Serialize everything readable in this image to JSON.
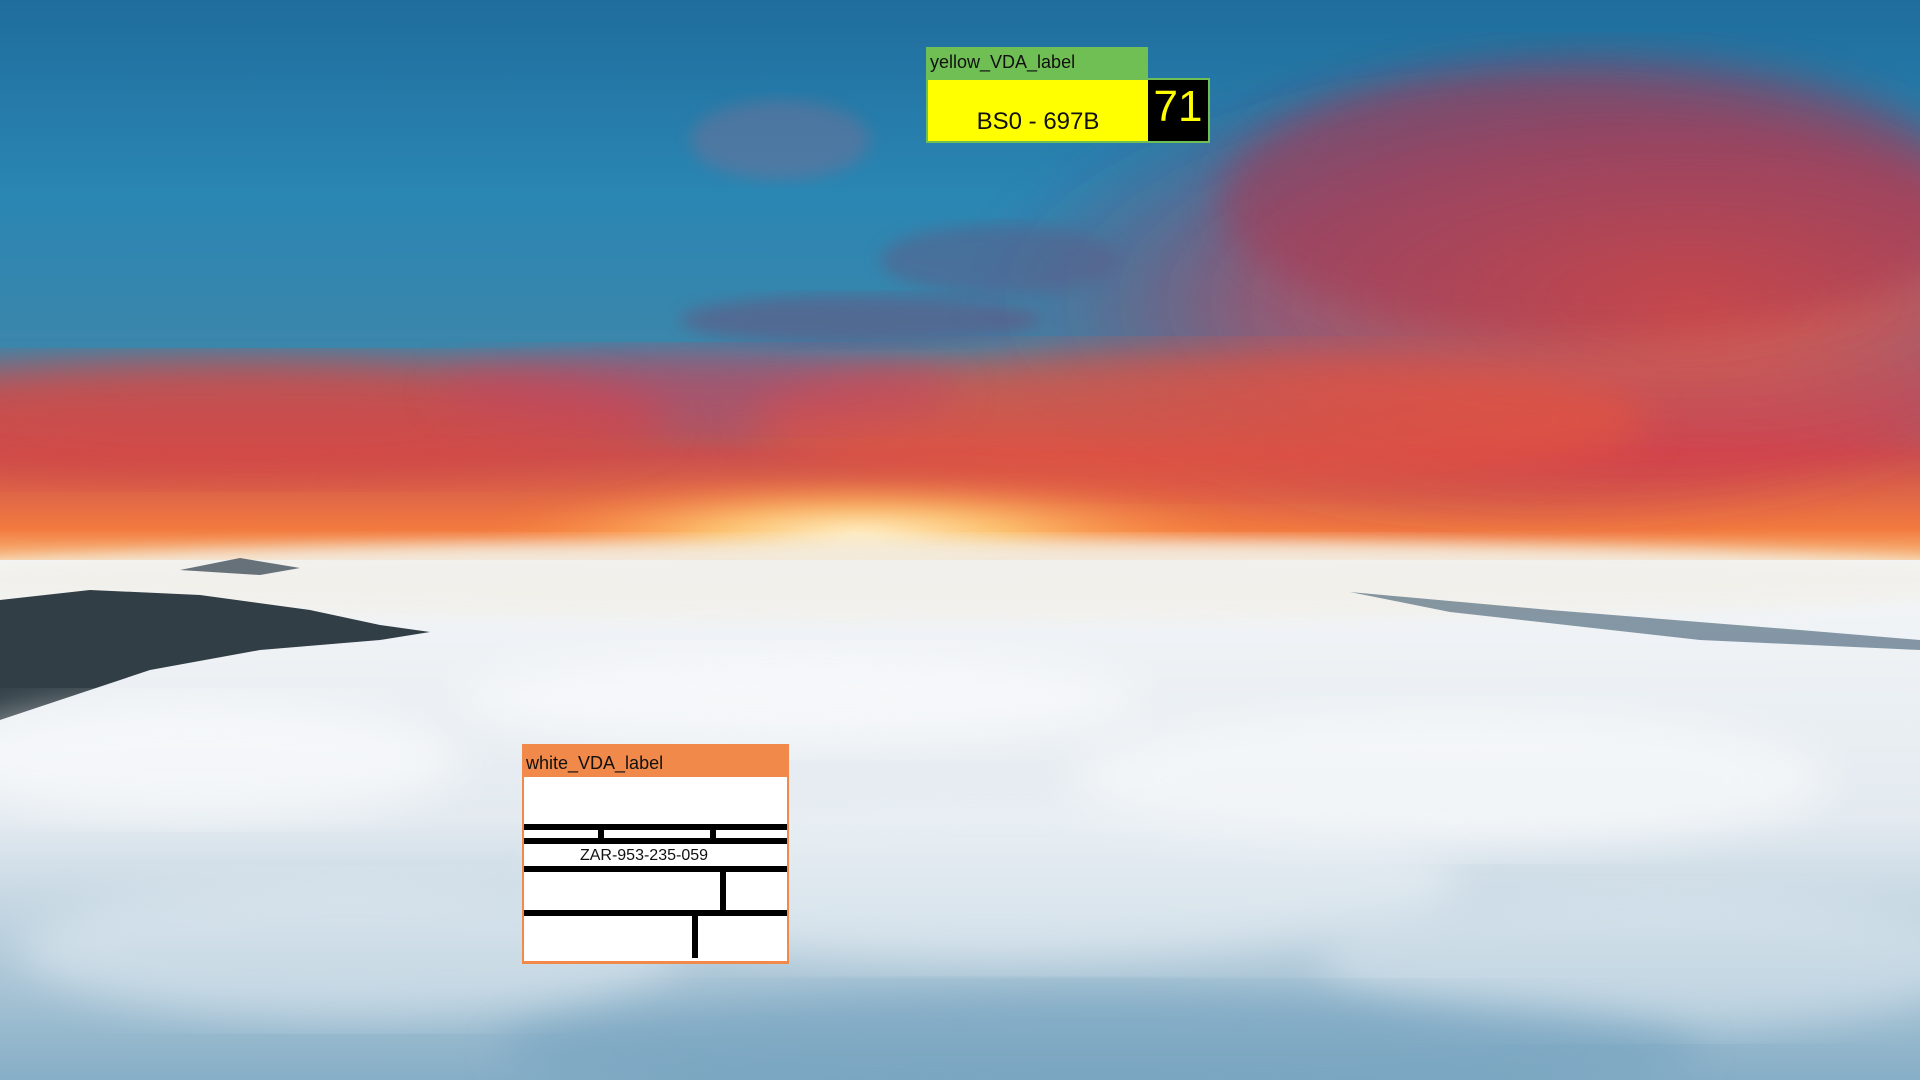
{
  "labels": {
    "yellow": {
      "tag": "yellow_VDA_label",
      "code": "BS0 - 697B",
      "number": "71",
      "tag_color": "#6fbf55",
      "fill_color": "#ffff00"
    },
    "white": {
      "tag": "white_VDA_label",
      "code": "ZAR-953-235-059",
      "tag_color": "#f0894a",
      "fill_color": "#ffffff"
    }
  }
}
